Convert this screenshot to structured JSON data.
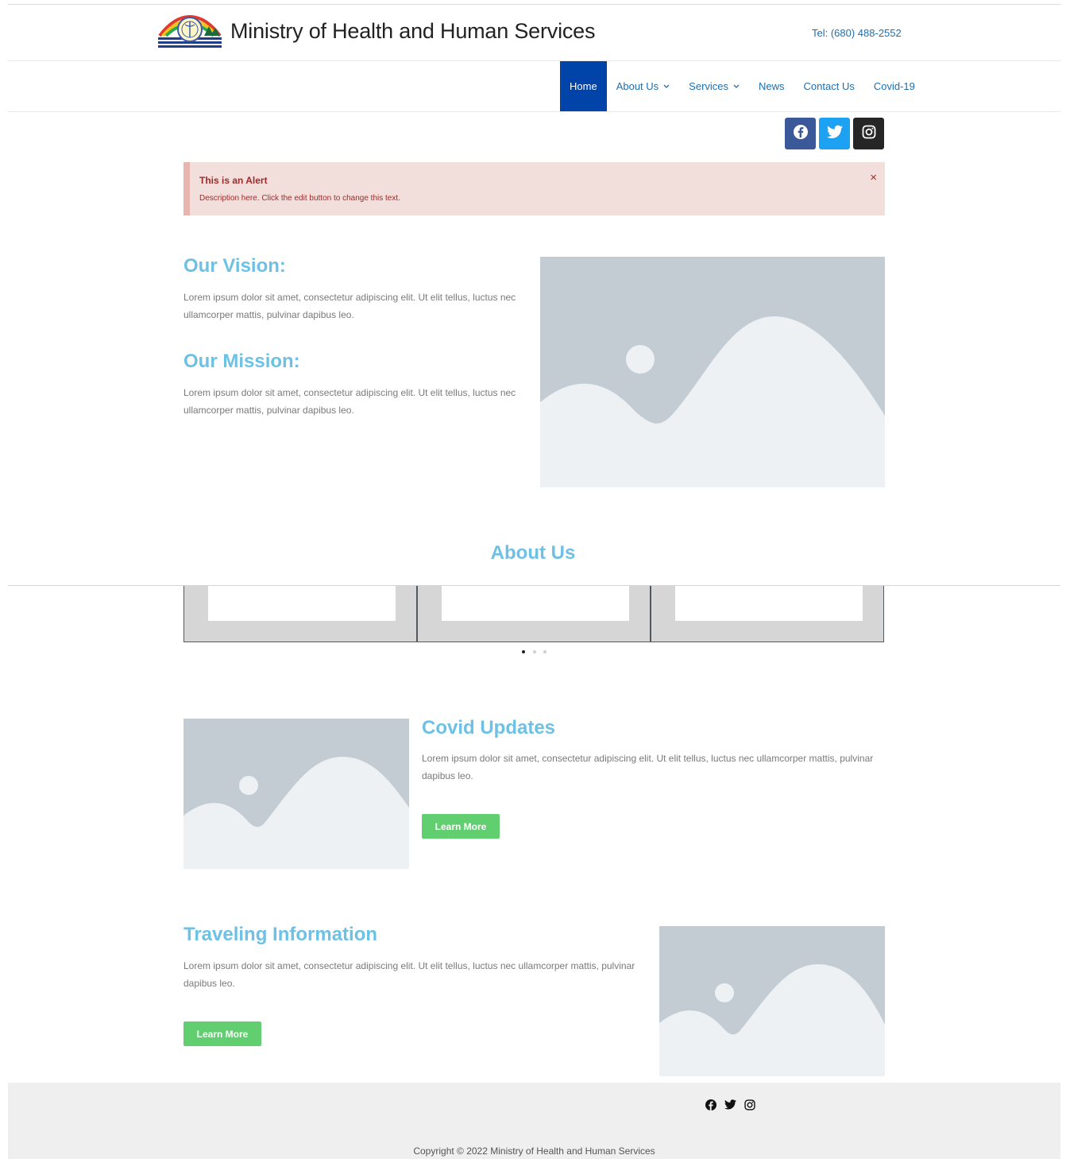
{
  "header": {
    "title": "Ministry of Health and Human Services",
    "tel": "Tel: (680) 488-2552",
    "logo_icon": "ministry-seal-logo"
  },
  "nav": {
    "items": [
      {
        "label": "Home",
        "active": true,
        "dropdown": false
      },
      {
        "label": "About Us",
        "active": false,
        "dropdown": true
      },
      {
        "label": "Services",
        "active": false,
        "dropdown": true
      },
      {
        "label": "News",
        "active": false,
        "dropdown": false
      },
      {
        "label": "Contact Us",
        "active": false,
        "dropdown": false
      },
      {
        "label": "Covid-19",
        "active": false,
        "dropdown": false
      }
    ],
    "chevron": "⌄"
  },
  "social": [
    {
      "name": "facebook-icon",
      "color": "#3b5998"
    },
    {
      "name": "twitter-icon",
      "color": "#1da1f2"
    },
    {
      "name": "instagram-icon",
      "color": "#262626"
    }
  ],
  "alert": {
    "title": "This is an Alert",
    "description": "Description here. Click the edit button to change this text.",
    "close": "×"
  },
  "vision": {
    "heading": "Our Vision:",
    "text": "Lorem ipsum dolor sit amet, consectetur adipiscing elit. Ut elit tellus, luctus nec ullamcorper mattis, pulvinar dapibus leo."
  },
  "mission": {
    "heading": "Our Mission:",
    "text": "Lorem ipsum dolor sit amet, consectetur adipiscing elit. Ut elit tellus, luctus nec ullamcorper mattis, pulvinar dapibus leo."
  },
  "about": {
    "heading": "About Us",
    "slides_count": 3,
    "active_dot": 0
  },
  "covid": {
    "heading": "Covid Updates",
    "text": "Lorem ipsum dolor sit amet, consectetur adipiscing elit. Ut elit tellus, luctus nec ullamcorper mattis, pulvinar dapibus leo.",
    "button": "Learn More"
  },
  "travel": {
    "heading": "Traveling Information",
    "text": "Lorem ipsum dolor sit amet, consectetur adipiscing elit. Ut elit tellus, luctus nec ullamcorper mattis, pulvinar dapibus leo.",
    "button": "Learn More"
  },
  "footer": {
    "copyright": "Copyright © 2022 Ministry of Health and Human Services"
  },
  "colors": {
    "accent": "#6ec1e4",
    "nav_active": "#0044a9",
    "link": "#1d6fb0",
    "button": "#61ce70",
    "alert_bg": "#f2dedb",
    "alert_text": "#9e2b2b"
  }
}
